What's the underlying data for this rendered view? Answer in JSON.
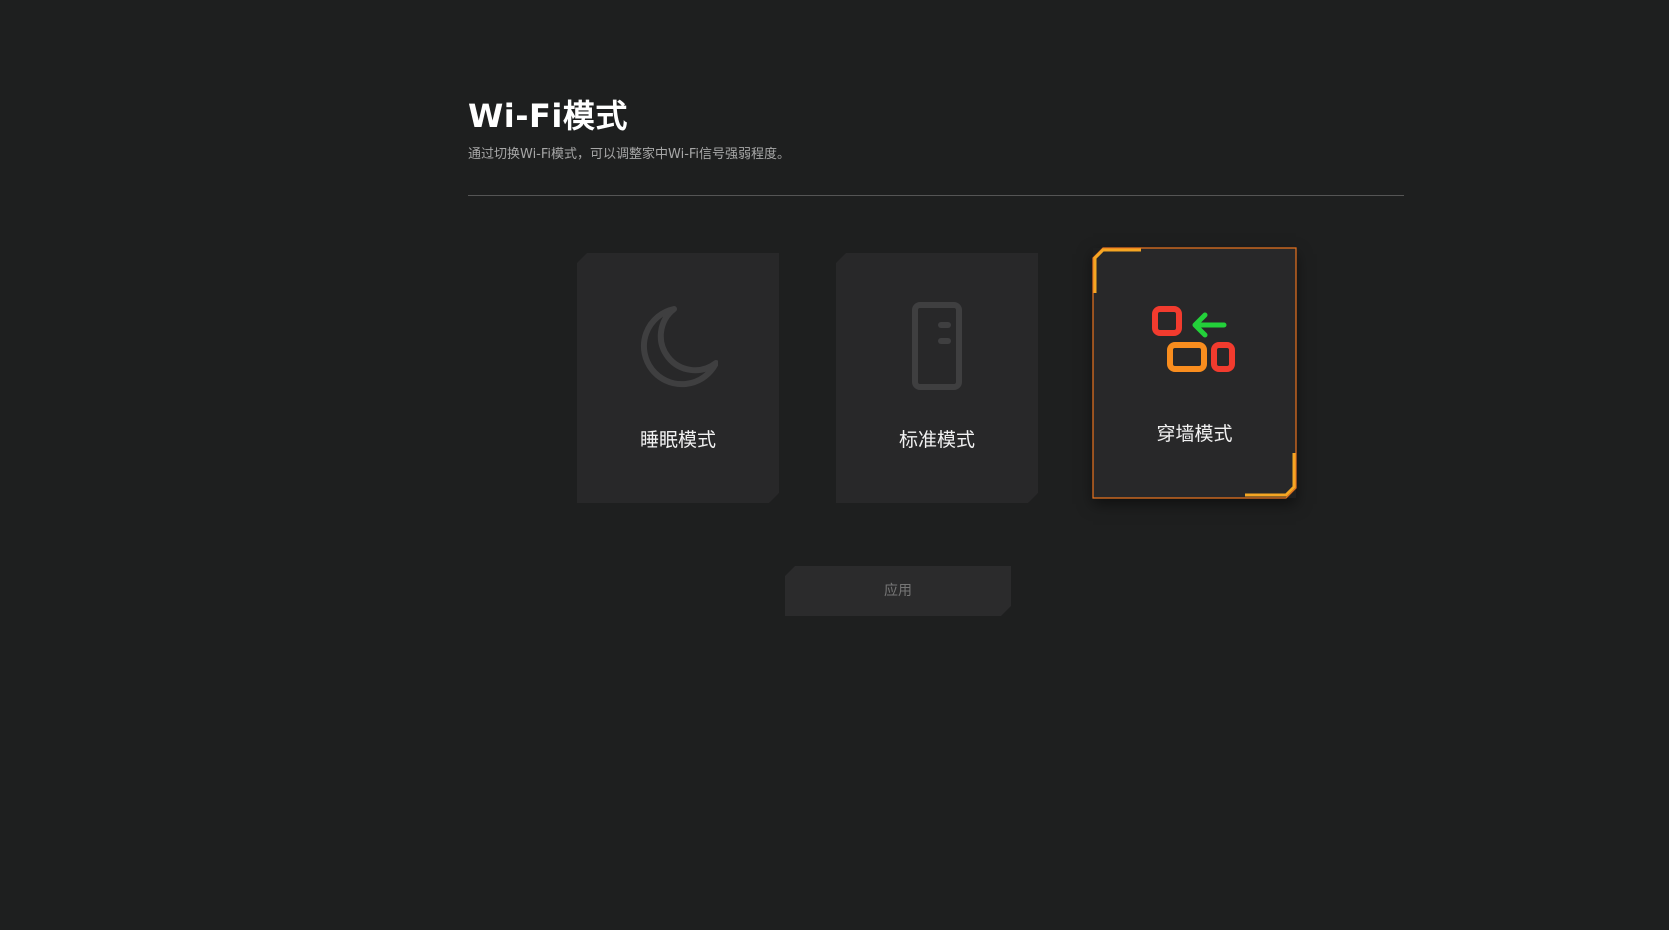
{
  "header": {
    "title": "Wi-Fi模式",
    "description": "通过切换Wi-Fi模式，可以调整家中Wi-Fi信号强弱程度。"
  },
  "modes": [
    {
      "label": "睡眠模式",
      "icon": "moon-icon",
      "selected": false
    },
    {
      "label": "标准模式",
      "icon": "standard-device-icon",
      "selected": false
    },
    {
      "label": "穿墙模式",
      "icon": "wall-penetration-icon",
      "selected": true
    }
  ],
  "apply": {
    "label": "应用"
  },
  "colors": {
    "background": "#1e1f1f",
    "card": "#282829",
    "selected_border": "#e8731f",
    "selected_corner": "#f5a623",
    "icon_inactive": "#3f3f40",
    "icon_red": "#f23b2e",
    "icon_orange": "#f98d1e",
    "icon_green": "#23d13a"
  }
}
